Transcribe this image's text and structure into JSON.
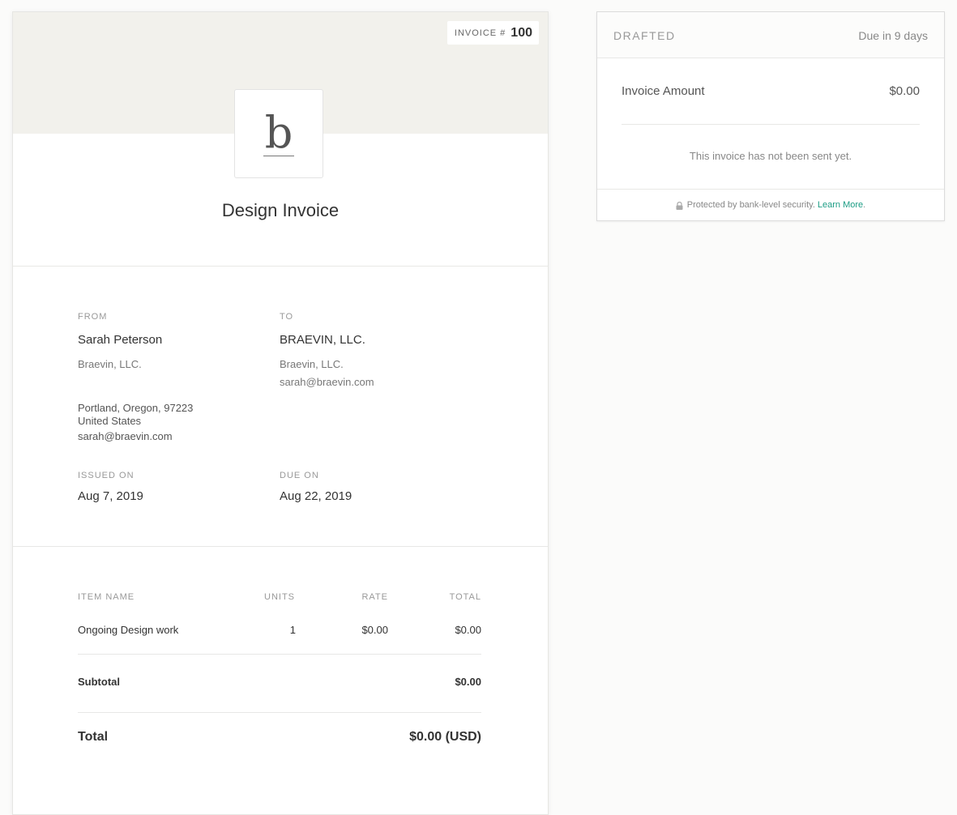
{
  "invoice": {
    "number_label": "INVOICE #",
    "number": "100",
    "logo_letter": "b",
    "title": "Design Invoice",
    "from": {
      "label": "FROM",
      "name": "Sarah Peterson",
      "company": "Braevin, LLC.",
      "address_line1": "Portland, Oregon, 97223",
      "address_line2": "United States",
      "email": "sarah@braevin.com"
    },
    "to": {
      "label": "TO",
      "name": "BRAEVIN, LLC.",
      "company": "Braevin, LLC.",
      "email": "sarah@braevin.com"
    },
    "issued": {
      "label": "ISSUED ON",
      "date": "Aug 7, 2019"
    },
    "due": {
      "label": "DUE ON",
      "date": "Aug 22, 2019"
    },
    "items_header": {
      "name": "ITEM NAME",
      "units": "UNITS",
      "rate": "RATE",
      "total": "TOTAL"
    },
    "items": [
      {
        "name": "Ongoing Design work",
        "units": "1",
        "rate": "$0.00",
        "total": "$0.00"
      }
    ],
    "subtotal_label": "Subtotal",
    "subtotal_value": "$0.00",
    "total_label": "Total",
    "total_value": "$0.00 (USD)"
  },
  "status_panel": {
    "status": "DRAFTED",
    "due_text": "Due in 9 days",
    "amount_label": "Invoice Amount",
    "amount_value": "$0.00",
    "not_sent_text": "This invoice has not been sent yet.",
    "security_text": "Protected by bank-level security.",
    "learn_more": "Learn More",
    "learn_more_suffix": ".",
    "link_color": "#1b9c84",
    "lock_icon": "lock-icon"
  }
}
